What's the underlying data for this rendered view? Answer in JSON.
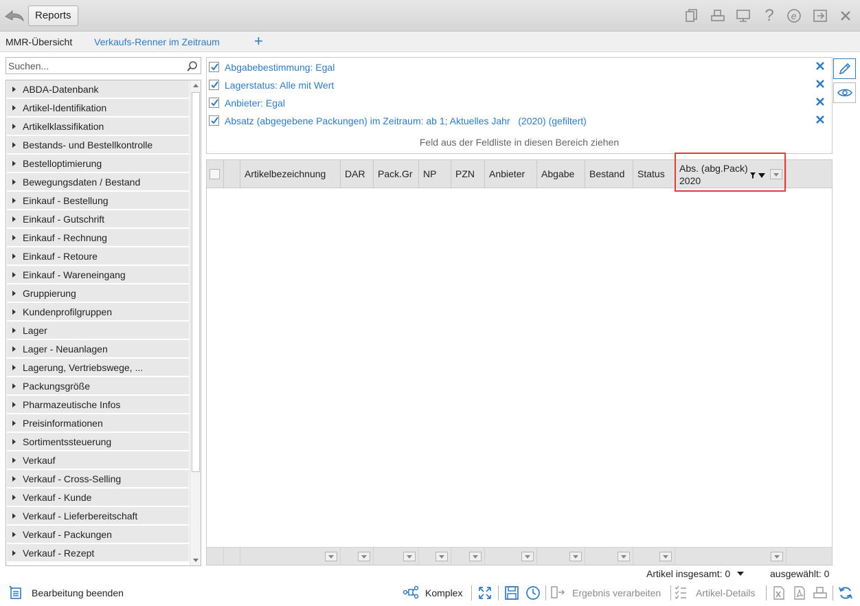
{
  "titlebar": {
    "reports_label": "Reports",
    "icons": [
      "copy-document-icon",
      "print-icon",
      "monitor-icon",
      "help-icon",
      "e-icon",
      "exit-icon",
      "close-icon"
    ]
  },
  "tabs": {
    "active": "MMR-Übersicht",
    "second": "Verkaufs-Renner im Zeitraum",
    "add": "+"
  },
  "search": {
    "placeholder": "Suchen..."
  },
  "tree": {
    "items": [
      "ABDA-Datenbank",
      "Artikel-Identifikation",
      "Artikelklassifikation",
      "Bestands- und Bestellkontrolle",
      "Bestelloptimierung",
      "Bewegungsdaten / Bestand",
      "Einkauf - Bestellung",
      "Einkauf - Gutschrift",
      "Einkauf - Rechnung",
      "Einkauf - Retoure",
      "Einkauf - Wareneingang",
      "Gruppierung",
      "Kundenprofilgruppen",
      "Lager",
      "Lager - Neuanlagen",
      "Lagerung, Vertriebswege, ...",
      "Packungsgröße",
      "Pharmazeutische Infos",
      "Preisinformationen",
      "Sortimentssteuerung",
      "Verkauf",
      "Verkauf - Cross-Selling",
      "Verkauf - Kunde",
      "Verkauf - Lieferbereitschaft",
      "Verkauf - Packungen",
      "Verkauf - Rezept"
    ]
  },
  "filters": {
    "items": [
      {
        "text": "Abgabebestimmung: Egal",
        "checked": true
      },
      {
        "text": "Lagerstatus: Alle mit Wert",
        "checked": true
      },
      {
        "text": "Anbieter: Egal",
        "checked": true
      },
      {
        "text": "Absatz (abgegebene Packungen) im Zeitraum: ab 1; Aktuelles Jahr   (2020) (gefiltert)",
        "checked": true
      }
    ],
    "drop_hint": "Feld aus der Feldliste in diesen Bereich ziehen"
  },
  "grid": {
    "columns": [
      "Artikelbezeichnung",
      "DAR",
      "Pack.Gr",
      "NP",
      "PZN",
      "Anbieter",
      "Abgabe",
      "Bestand",
      "Status"
    ],
    "highlight_column": {
      "line1": "Abs. (abg.Pack)",
      "line2": "2020"
    }
  },
  "status": {
    "total": "Artikel insgesamt: 0",
    "selected": "ausgewählt: 0"
  },
  "bottom": {
    "finish_edit": "Bearbeitung beenden",
    "complex": "Komplex",
    "process_result": "Ergebnis verarbeiten",
    "article_details": "Artikel-Details"
  },
  "colors": {
    "link_blue": "#2d7bc4",
    "highlight_red": "#e03c31"
  }
}
